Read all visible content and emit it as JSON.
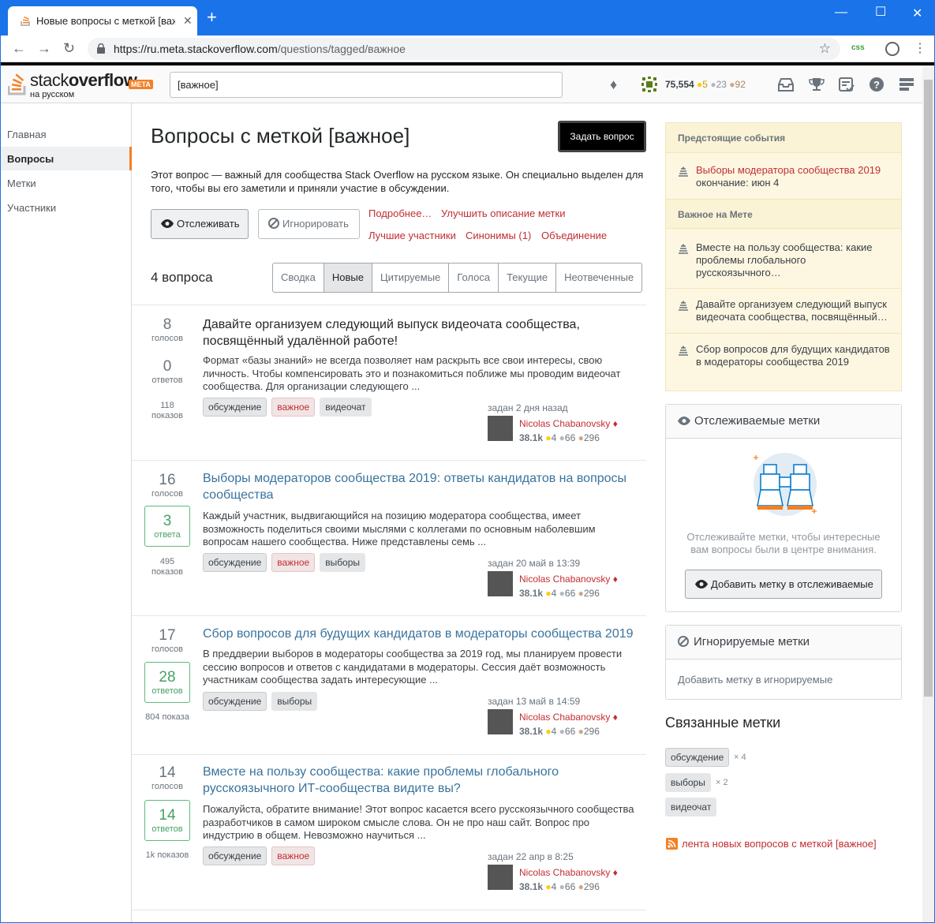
{
  "browser": {
    "tab_title": "Новые вопросы с меткой [важ",
    "url_host": "https://ru.meta.stackoverflow.com",
    "url_path": "/questions/tagged/важное",
    "ext_label": "css"
  },
  "topbar": {
    "logo_text_1": "stack",
    "logo_text_2": "overflow",
    "logo_sub": "на русском",
    "meta_badge": "META",
    "search_value": "[важное]",
    "reputation": "75,554",
    "gold": "5",
    "silver": "23",
    "bronze": "92"
  },
  "leftnav": {
    "items": [
      "Главная",
      "Вопросы",
      "Метки",
      "Участники"
    ]
  },
  "header": {
    "title": "Вопросы с меткой [важное]",
    "ask_button": "Задать вопрос",
    "description": "Этот вопрос — важный для сообщества Stack Overflow на русском языке. Он специально выделен для того, чтобы вы его заметили и приняли участие в обсуждении.",
    "watch_button": "Отслеживать",
    "ignore_button": "Игнорировать",
    "links": [
      "Подробнее…",
      "Улучшить описание метки",
      "Лучшие участники",
      "Синонимы (1)",
      "Объединение"
    ]
  },
  "list": {
    "count": "4 вопроса",
    "tabs": [
      "Сводка",
      "Новые",
      "Цитируемые",
      "Голоса",
      "Текущие",
      "Неотвеченные"
    ],
    "active_tab": "Новые"
  },
  "questions": [
    {
      "votes": "8",
      "votes_label": "голосов",
      "answers": "0",
      "answers_label": "ответов",
      "views": "118",
      "views_label": "показов",
      "title": "Давайте организуем следующий выпуск видеочата сообщества, посвящённый удалённой работе!",
      "excerpt": "Формат «базы знаний» не всегда позволяет нам раскрыть все свои интересы, свою личность. Чтобы компенсировать это и познакомиться поближе мы проводим видеочат сообщества. Для организации следующего ...",
      "tags": [
        "обсуждение",
        "важное",
        "видеочат"
      ],
      "asked": "задан 2 дня назад",
      "user": "Nicolas Chabanovsky ♦",
      "rep": "38.1k",
      "gold": "4",
      "silver": "66",
      "bronze": "296"
    },
    {
      "votes": "16",
      "votes_label": "голосов",
      "answers": "3",
      "answers_label": "ответа",
      "views": "495",
      "views_label": "показов",
      "title": "Выборы модераторов сообщества 2019: ответы кандидатов на вопросы сообщества",
      "excerpt": "Каждый участник, выдвигающийся на позицию модератора сообщества, имеет возможность поделиться своими мыслями с коллегами по основным наболевшим вопросам нашего сообщества. Ниже представлены семь ...",
      "tags": [
        "обсуждение",
        "важное",
        "выборы"
      ],
      "asked": "задан 20 май в 13:39",
      "user": "Nicolas Chabanovsky ♦",
      "rep": "38.1k",
      "gold": "4",
      "silver": "66",
      "bronze": "296"
    },
    {
      "votes": "17",
      "votes_label": "голосов",
      "answers": "28",
      "answers_label": "ответов",
      "views": "804 показа",
      "views_label": "",
      "title": "Сбор вопросов для будущих кандидатов в модераторы сообщества 2019",
      "excerpt": "В преддверии выборов в модераторы сообщества за 2019 год, мы планируем провести сессию вопросов и ответов с кандидатами в модераторы. Сессия даёт возможность участникам сообщества задать интересующие ...",
      "tags": [
        "обсуждение",
        "выборы"
      ],
      "asked": "задан 13 май в 14:59",
      "user": "Nicolas Chabanovsky ♦",
      "rep": "38.1k",
      "gold": "4",
      "silver": "66",
      "bronze": "296"
    },
    {
      "votes": "14",
      "votes_label": "голосов",
      "answers": "14",
      "answers_label": "ответов",
      "views": "1k показов",
      "views_label": "",
      "title": "Вместе на пользу сообщества: какие проблемы глобального русскоязычного ИТ-сообщества видите вы?",
      "excerpt": "Пожалуйста, обратите внимание! Этот вопрос касается всего русскоязычного сообщества разработчиков в самом широком смысле слова. Он не про наш сайт. Вопрос про индустрию в общем. Невозможно научиться ...",
      "tags": [
        "обсуждение",
        "важное"
      ],
      "asked": "задан 22 апр в 8:25",
      "user": "Nicolas Chabanovsky ♦",
      "rep": "38.1k",
      "gold": "4",
      "silver": "66",
      "bronze": "296"
    }
  ],
  "sidebar": {
    "events_header": "Предстоящие события",
    "event_title": "Выборы модератора сообщества 2019",
    "event_sub": "окончание: июн 4",
    "meta_header": "Важное на Мете",
    "meta_items": [
      "Вместе на пользу сообщества: какие проблемы глобального русскоязычного…",
      "Давайте организуем следующий выпуск видеочата сообщества, посвящённый…",
      "Сбор вопросов для будущих кандидатов в модераторы сообщества 2019"
    ],
    "watched_header": "Отслеживаемые метки",
    "watched_text": "Отслеживайте метки, чтобы интересные вам вопросы были в центре внимания.",
    "watched_button": "Добавить метку в отслеживаемые",
    "ignored_header": "Игнорируемые метки",
    "ignored_link": "Добавить метку в игнорируемые",
    "related_header": "Связанные метки",
    "related": [
      {
        "tag": "обсуждение",
        "mult": "× 4"
      },
      {
        "tag": "выборы",
        "mult": "× 2"
      },
      {
        "tag": "видеочат",
        "mult": ""
      }
    ],
    "feed": "лента новых вопросов с меткой [важное]"
  }
}
